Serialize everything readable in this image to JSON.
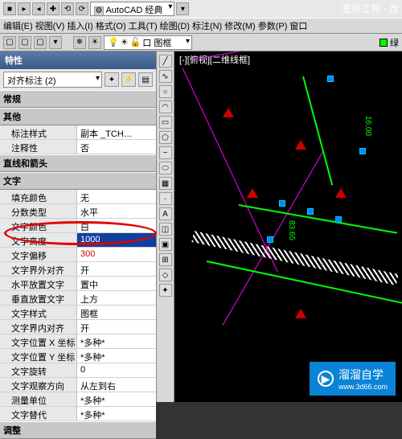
{
  "app": {
    "title_right": "室外工程 - 改",
    "workspace": "AutoCAD 经典"
  },
  "menu": {
    "edit": "编辑(E)",
    "view": "视图(V)",
    "insert": "插入(I)",
    "format": "格式(O)",
    "tools": "工具(T)",
    "draw": "绘图(D)",
    "dimension": "标注(N)",
    "modify": "修改(M)",
    "param": "参数(P)",
    "window": "窗口"
  },
  "toolbar": {
    "layer_name": "口 图框",
    "color_label": "绿"
  },
  "canvas": {
    "viewport_label": "[-][俯视][二维线框]",
    "dim1": "16.00",
    "dim2": "83.65"
  },
  "props": {
    "title": "特性",
    "selection": "对齐标注 (2)",
    "cats": {
      "general": "常规",
      "other": "其他",
      "lines_arrows": "直线和箭头",
      "text": "文字",
      "adjust": "调整"
    },
    "rows": {
      "dim_style_k": "标注样式",
      "dim_style_v": "副本 _TCH…",
      "annotative_k": "注释性",
      "annotative_v": "否",
      "text_fill_k": "填充颜色",
      "text_fill_v": "无",
      "fraction_type_k": "分数类型",
      "fraction_type_v": "水平",
      "text_color_k": "文字颜色",
      "text_color_v": "白",
      "text_height_k": "文字高度",
      "text_height_v": "1000",
      "text_offset_k": "文字偏移",
      "text_offset_v": "300",
      "text_align_out_k": "文字界外对齐",
      "text_align_out_v": "开",
      "text_pos_h_k": "水平放置文字",
      "text_pos_h_v": "置中",
      "text_pos_v_k": "垂直放置文字",
      "text_pos_v_v": "上方",
      "text_style_k": "文字样式",
      "text_style_v": "图框",
      "text_in_align_k": "文字界内对齐",
      "text_in_align_v": "开",
      "text_x_k": "文字位置 X 坐标",
      "text_x_v": "*多种*",
      "text_y_k": "文字位置 Y 坐标",
      "text_y_v": "*多种*",
      "text_rot_k": "文字旋转",
      "text_rot_v": "0",
      "text_view_dir_k": "文字观察方向",
      "text_view_dir_v": "从左到右",
      "meas_unit_k": "测量单位",
      "meas_unit_v": "*多种*",
      "text_override_k": "文字替代",
      "text_override_v": "*多种*"
    }
  },
  "watermark": {
    "brand": "溜溜自学",
    "url": "www.3d66.com"
  }
}
